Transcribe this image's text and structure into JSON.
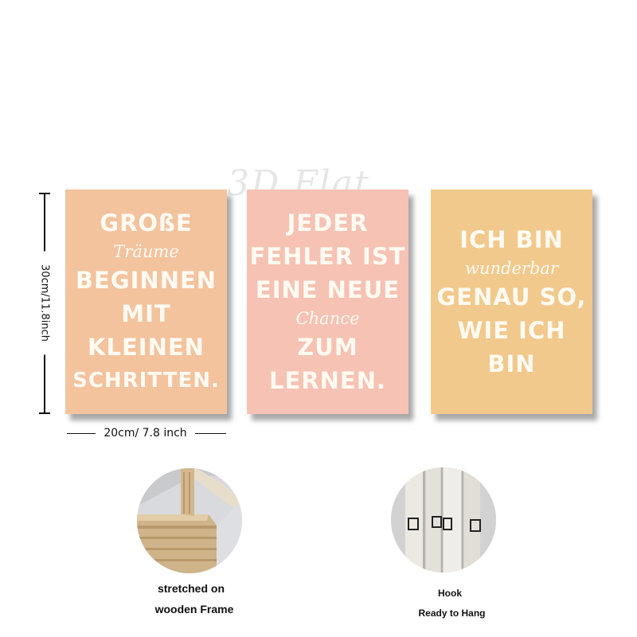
{
  "watermark": "3D Flat",
  "posters": [
    {
      "lines": [
        {
          "text": "GROßE",
          "style": "bold"
        },
        {
          "text": "Träume",
          "style": "script"
        },
        {
          "text": "BEGINNEN",
          "style": "bold"
        },
        {
          "text": "MIT",
          "style": "bold"
        },
        {
          "text": "KLEINEN",
          "style": "bold"
        },
        {
          "text": "SCHRITTEN.",
          "style": "bold"
        }
      ],
      "color": "#f3c39e"
    },
    {
      "lines": [
        {
          "text": "JEDER",
          "style": "bold"
        },
        {
          "text": "FEHLER IST",
          "style": "bold"
        },
        {
          "text": "EINE NEUE",
          "style": "bold"
        },
        {
          "text": "Chance",
          "style": "script"
        },
        {
          "text": "ZUM",
          "style": "bold"
        },
        {
          "text": "LERNEN.",
          "style": "bold"
        }
      ],
      "color": "#f6c2b3"
    },
    {
      "lines": [
        {
          "text": "ICH BIN",
          "style": "bold"
        },
        {
          "text": "wunderbar",
          "style": "script"
        },
        {
          "text": "GENAU SO,",
          "style": "bold"
        },
        {
          "text": "WIE ICH",
          "style": "bold"
        },
        {
          "text": "BIN",
          "style": "bold"
        }
      ],
      "color": "#f2c98c"
    }
  ],
  "dimensions": {
    "height_label": "30cm/11.8inch",
    "width_label": "20cm/ 7.8 inch"
  },
  "features": {
    "frame_caption_line1": "stretched on",
    "frame_caption_line2": "wooden Frame",
    "hook_caption_line1": "Hook",
    "hook_caption_line2": "Ready to Hang"
  }
}
